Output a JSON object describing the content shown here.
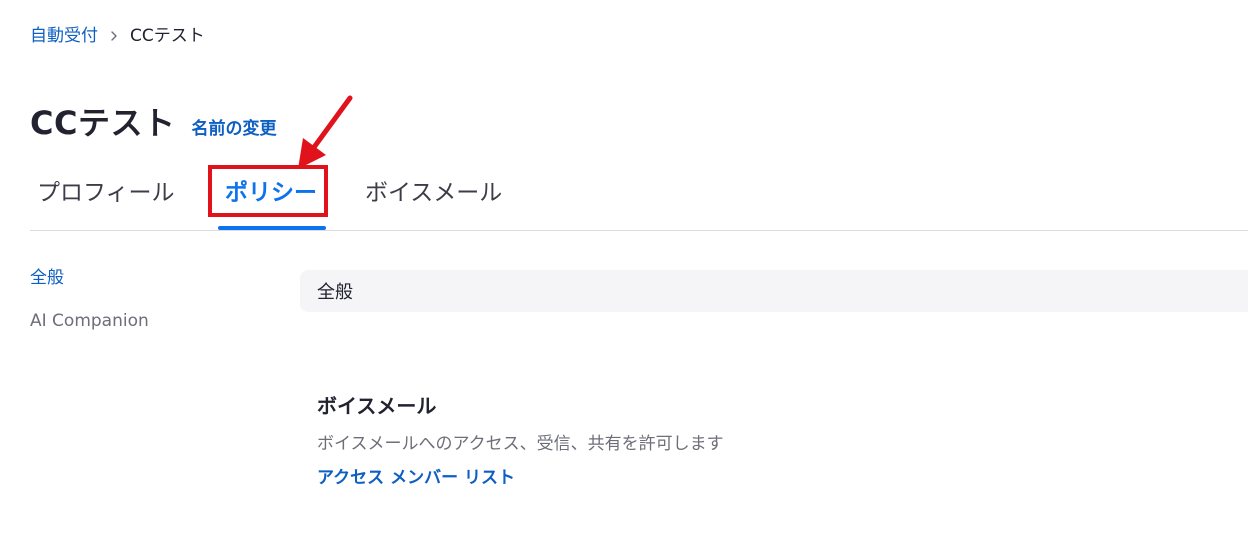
{
  "breadcrumb": {
    "parent": "自動受付",
    "current": "CCテスト"
  },
  "header": {
    "title": "CCテスト",
    "rename_link": "名前の変更"
  },
  "tabs": [
    {
      "label": "プロフィール",
      "active": false
    },
    {
      "label": "ポリシー",
      "active": true
    },
    {
      "label": "ボイスメール",
      "active": false
    }
  ],
  "sidebar": {
    "items": [
      {
        "label": "全般",
        "active": true
      },
      {
        "label": "AI Companion",
        "active": false
      }
    ]
  },
  "section": {
    "header": "全般"
  },
  "setting": {
    "title": "ボイスメール",
    "description": "ボイスメールへのアクセス、受信、共有を許可します",
    "link": "アクセス メンバー リスト"
  },
  "colors": {
    "link": "#0e5fc2",
    "active_tab": "#0e72ed",
    "annotation": "#e0121b"
  }
}
